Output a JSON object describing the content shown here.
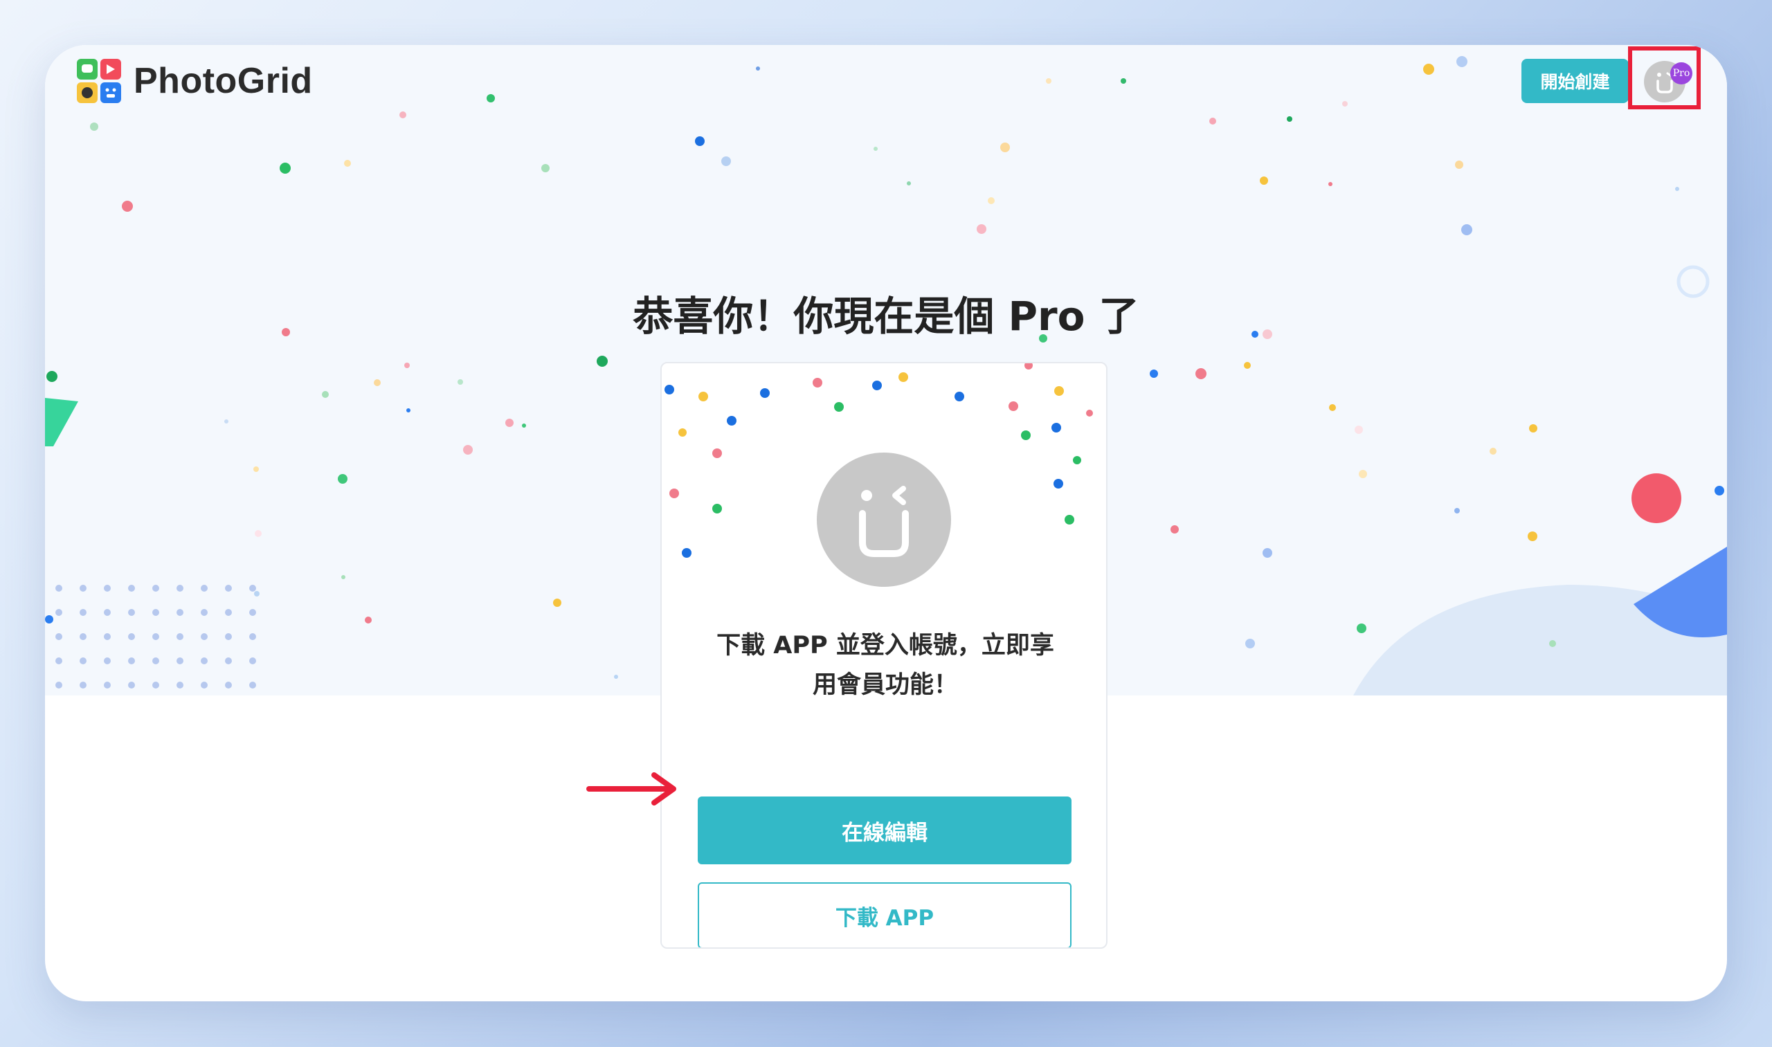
{
  "brand": {
    "name": "PhotoGrid",
    "logo_icon": "photogrid-logo-icon"
  },
  "header": {
    "start_button": "開始創建",
    "avatar_badge": "Pro"
  },
  "hero": {
    "title": "恭喜你！你現在是個 Pro 了"
  },
  "card": {
    "message_line1": "下載 APP 並登入帳號，立即享",
    "message_line2": "用會員功能！",
    "primary_button": "在線編輯",
    "secondary_button": "下載 APP"
  },
  "colors": {
    "accent": "#33b9c7",
    "highlight": "#e9203a",
    "pro_badge": "#9a45de"
  }
}
